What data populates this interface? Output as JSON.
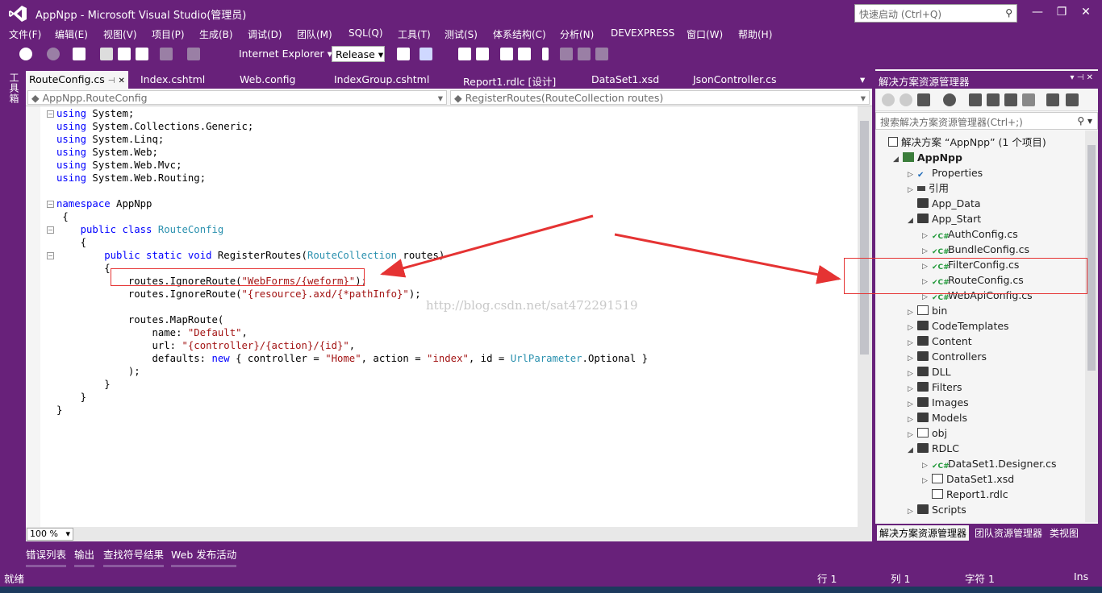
{
  "window": {
    "title": "AppNpp - Microsoft Visual Studio(管理员)",
    "quick_launch_placeholder": "快速启动 (Ctrl+Q)",
    "minimize": "—",
    "restore": "❐",
    "close": "✕"
  },
  "menu": [
    "文件(F)",
    "编辑(E)",
    "视图(V)",
    "项目(P)",
    "生成(B)",
    "调试(D)",
    "团队(M)",
    "SQL(Q)",
    "工具(T)",
    "测试(S)",
    "体系结构(C)",
    "分析(N)",
    "DEVEXPRESS",
    "窗口(W)",
    "帮助(H)"
  ],
  "toolbar": {
    "browser": "Internet Explorer",
    "configuration": "Release"
  },
  "toolbox_label": "工具箱",
  "tabs": [
    {
      "label": "RouteConfig.cs",
      "active": true
    },
    {
      "label": "Index.cshtml"
    },
    {
      "label": "Web.config"
    },
    {
      "label": "IndexGroup.cshtml"
    },
    {
      "label": "Report1.rdlc [设计]"
    },
    {
      "label": "DataSet1.xsd"
    },
    {
      "label": "JsonController.cs"
    }
  ],
  "nav": {
    "class_dropdown": "AppNpp.RouteConfig",
    "member_dropdown": "RegisterRoutes(RouteCollection routes)"
  },
  "code": [
    [
      {
        "k": "kw",
        "t": "using"
      },
      {
        "t": " System;"
      }
    ],
    [
      {
        "k": "kw",
        "t": "using"
      },
      {
        "t": " System.Collections.Generic;"
      }
    ],
    [
      {
        "k": "kw",
        "t": "using"
      },
      {
        "t": " System.Linq;"
      }
    ],
    [
      {
        "k": "kw",
        "t": "using"
      },
      {
        "t": " System.Web;"
      }
    ],
    [
      {
        "k": "kw",
        "t": "using"
      },
      {
        "t": " System.Web.Mvc;"
      }
    ],
    [
      {
        "k": "kw",
        "t": "using"
      },
      {
        "t": " System.Web.Routing;"
      }
    ],
    [
      {
        "t": ""
      }
    ],
    [
      {
        "k": "kw",
        "t": "namespace"
      },
      {
        "t": " AppNpp"
      }
    ],
    [
      {
        "t": " {"
      }
    ],
    [
      {
        "t": "    "
      },
      {
        "k": "kw",
        "t": "public class"
      },
      {
        "t": " "
      },
      {
        "k": "ty",
        "t": "RouteConfig"
      }
    ],
    [
      {
        "t": "    {"
      }
    ],
    [
      {
        "t": "        "
      },
      {
        "k": "kw",
        "t": "public static void"
      },
      {
        "t": " RegisterRoutes("
      },
      {
        "k": "ty",
        "t": "RouteCollection"
      },
      {
        "t": " routes)"
      }
    ],
    [
      {
        "t": "        {"
      }
    ],
    [
      {
        "t": "            routes.IgnoreRoute("
      },
      {
        "k": "st",
        "t": "\"WebForms/{weform}\""
      },
      {
        "t": ");"
      }
    ],
    [
      {
        "t": "            routes.IgnoreRoute("
      },
      {
        "k": "st",
        "t": "\"{resource}.axd/{*pathInfo}\""
      },
      {
        "t": ");"
      }
    ],
    [
      {
        "t": ""
      }
    ],
    [
      {
        "t": "            routes.MapRoute("
      }
    ],
    [
      {
        "t": "                name: "
      },
      {
        "k": "st",
        "t": "\"Default\""
      },
      {
        "t": ","
      }
    ],
    [
      {
        "t": "                url: "
      },
      {
        "k": "st",
        "t": "\"{controller}/{action}/{id}\""
      },
      {
        "t": ","
      }
    ],
    [
      {
        "t": "                defaults: "
      },
      {
        "k": "kw",
        "t": "new"
      },
      {
        "t": " { controller = "
      },
      {
        "k": "st",
        "t": "\"Home\""
      },
      {
        "t": ", action = "
      },
      {
        "k": "st",
        "t": "\"index\""
      },
      {
        "t": ", id = "
      },
      {
        "k": "ty",
        "t": "UrlParameter"
      },
      {
        "t": ".Optional }"
      }
    ],
    [
      {
        "t": "            );"
      }
    ],
    [
      {
        "t": "        }"
      }
    ],
    [
      {
        "t": "    }"
      }
    ],
    [
      {
        "t": "}"
      }
    ]
  ],
  "zoom": "100 %",
  "watermark": "http://blog.csdn.net/sat472291519",
  "solution_explorer": {
    "title": "解决方案资源管理器",
    "search_placeholder": "搜索解决方案资源管理器(Ctrl+;)",
    "items": [
      {
        "label": "解决方案 “AppNpp” (1 个项目)",
        "indent": 0,
        "icon": "sln",
        "exp": ""
      },
      {
        "label": "AppNpp",
        "indent": 1,
        "icon": "proj",
        "exp": "◢",
        "bold": true
      },
      {
        "label": "Properties",
        "indent": 2,
        "icon": "prop",
        "exp": "▷"
      },
      {
        "label": "引用",
        "indent": 2,
        "icon": "ref",
        "exp": "▷"
      },
      {
        "label": "App_Data",
        "indent": 2,
        "icon": "folder",
        "exp": ""
      },
      {
        "label": "App_Start",
        "indent": 2,
        "icon": "folder",
        "exp": "◢"
      },
      {
        "label": "AuthConfig.cs",
        "indent": 3,
        "icon": "cs",
        "exp": "▷"
      },
      {
        "label": "BundleConfig.cs",
        "indent": 3,
        "icon": "cs",
        "exp": "▷"
      },
      {
        "label": "FilterConfig.cs",
        "indent": 3,
        "icon": "cs",
        "exp": "▷"
      },
      {
        "label": "RouteConfig.cs",
        "indent": 3,
        "icon": "cs",
        "exp": "▷"
      },
      {
        "label": "WebApiConfig.cs",
        "indent": 3,
        "icon": "cs",
        "exp": "▷"
      },
      {
        "label": "bin",
        "indent": 2,
        "icon": "file",
        "exp": "▷"
      },
      {
        "label": "CodeTemplates",
        "indent": 2,
        "icon": "folder",
        "exp": "▷"
      },
      {
        "label": "Content",
        "indent": 2,
        "icon": "folder",
        "exp": "▷"
      },
      {
        "label": "Controllers",
        "indent": 2,
        "icon": "folder",
        "exp": "▷"
      },
      {
        "label": "DLL",
        "indent": 2,
        "icon": "folder",
        "exp": "▷"
      },
      {
        "label": "Filters",
        "indent": 2,
        "icon": "folder",
        "exp": "▷"
      },
      {
        "label": "Images",
        "indent": 2,
        "icon": "folder",
        "exp": "▷"
      },
      {
        "label": "Models",
        "indent": 2,
        "icon": "folder",
        "exp": "▷"
      },
      {
        "label": "obj",
        "indent": 2,
        "icon": "file",
        "exp": "▷"
      },
      {
        "label": "RDLC",
        "indent": 2,
        "icon": "folder",
        "exp": "◢"
      },
      {
        "label": "DataSet1.Designer.cs",
        "indent": 3,
        "icon": "cs",
        "exp": "▷"
      },
      {
        "label": "DataSet1.xsd",
        "indent": 3,
        "icon": "file",
        "exp": "▷"
      },
      {
        "label": "Report1.rdlc",
        "indent": 3,
        "icon": "file",
        "exp": ""
      },
      {
        "label": "Scripts",
        "indent": 2,
        "icon": "folder",
        "exp": "▷"
      }
    ],
    "bottom_tabs": [
      "解决方案资源管理器",
      "团队资源管理器",
      "类视图"
    ]
  },
  "bottom_tabs": [
    "错误列表",
    "输出",
    "查找符号结果",
    "Web 发布活动"
  ],
  "status": {
    "ready": "就绪",
    "line": "行 1",
    "col": "列 1",
    "char": "字符 1",
    "ins": "Ins"
  },
  "colors": {
    "chrome": "#68217a",
    "keyword": "#0000ff",
    "type": "#2b91af",
    "string": "#a31515",
    "annotation": "#e53333"
  }
}
